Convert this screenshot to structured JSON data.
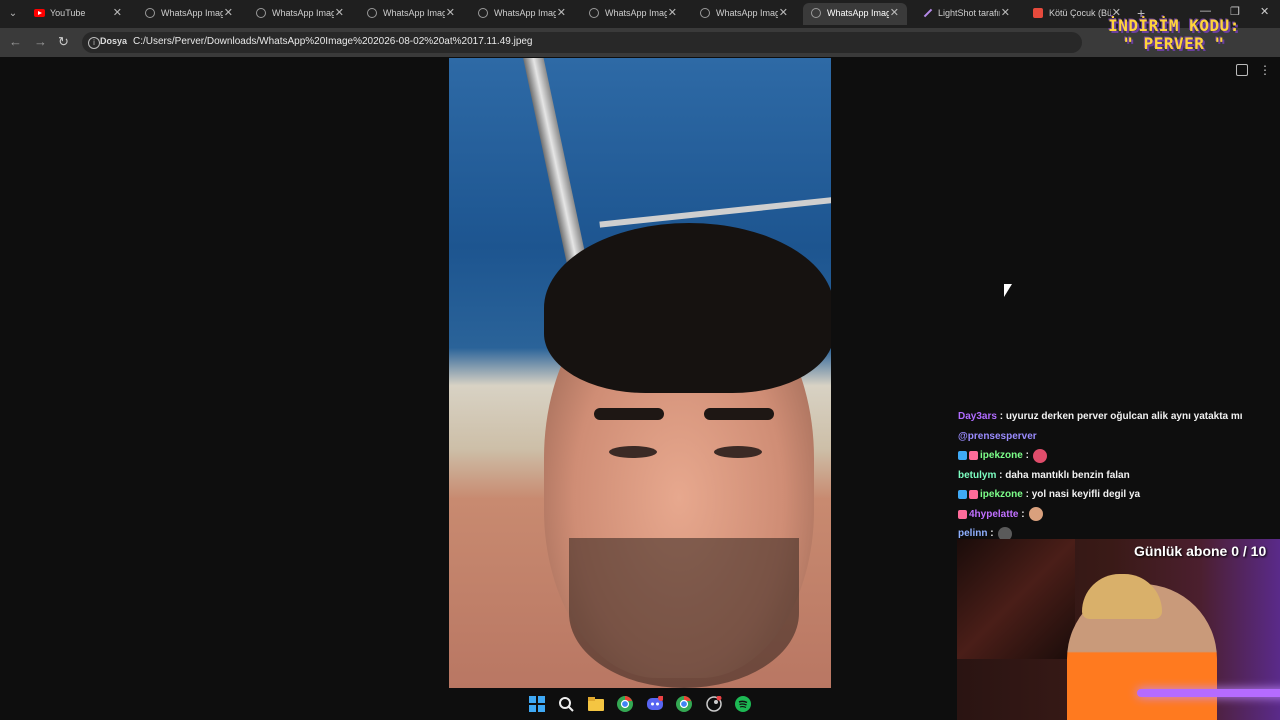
{
  "tabs": [
    {
      "title": "YouTube",
      "icon": "youtube-icon"
    },
    {
      "title": "WhatsApp Image",
      "icon": "globe-icon"
    },
    {
      "title": "WhatsApp Image",
      "icon": "globe-icon"
    },
    {
      "title": "WhatsApp Image",
      "icon": "globe-icon"
    },
    {
      "title": "WhatsApp Image",
      "icon": "globe-icon"
    },
    {
      "title": "WhatsApp Image",
      "icon": "globe-icon"
    },
    {
      "title": "WhatsApp Image",
      "icon": "globe-icon"
    },
    {
      "title": "WhatsApp Image",
      "icon": "globe-icon",
      "active": true
    },
    {
      "title": "LightShot tarafınd",
      "icon": "lightshot-icon"
    },
    {
      "title": "Kötü Çocuk (Büg",
      "icon": "music-icon"
    }
  ],
  "toolbar": {
    "file_chip": "Dosya",
    "url": "C:/Users/Perver/Downloads/WhatsApp%20Image%202026-08-02%20at%2017.11.49.jpeg"
  },
  "overlay": {
    "promo_line1": "İNDİRİM KODU:",
    "promo_line2": "\" PERVER \"",
    "subscriber_goal": "Günlük abone 0 / 10"
  },
  "chat": [
    {
      "user": "Day3ars",
      "user_color": "#b06cff",
      "message": "uyuruz derken perver oğulcan alik aynı yatakta mı"
    },
    {
      "user": "",
      "user_color": "#9b8cff",
      "message": "@prensesperver"
    },
    {
      "user": "ipekzone",
      "user_color": "#7dff8a",
      "message": "",
      "emote": true
    },
    {
      "user": "betulym",
      "user_color": "#7dffc2",
      "message": "daha mantıklı benzin falan"
    },
    {
      "user": "ipekzone",
      "user_color": "#7dff8a",
      "message": "yol nasi keyifli degil ya"
    },
    {
      "user": "4hypelatte",
      "user_color": "#c070ff",
      "message": "",
      "emote": true
    },
    {
      "user": "pelinn",
      "user_color": "#8fb0ff",
      "message": "",
      "emote": true
    }
  ],
  "taskbar": [
    "windows-start-icon",
    "search-icon",
    "file-explorer-icon",
    "chrome-icon",
    "discord-icon",
    "chrome-icon",
    "steam-icon",
    "spotify-icon"
  ],
  "colors": {
    "promo": "#ffd43b",
    "accent": "#b56bff"
  }
}
